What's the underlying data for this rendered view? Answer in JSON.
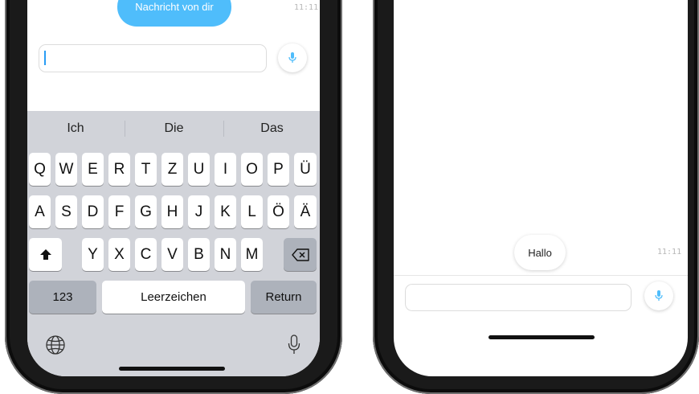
{
  "left_phone": {
    "message": {
      "text": "Nachricht von dir",
      "time": "11:11"
    },
    "input_value": "",
    "suggestions": [
      "Ich",
      "Die",
      "Das"
    ],
    "rows": [
      [
        "Q",
        "W",
        "E",
        "R",
        "T",
        "Z",
        "U",
        "I",
        "O",
        "P",
        "Ü"
      ],
      [
        "A",
        "S",
        "D",
        "F",
        "G",
        "H",
        "J",
        "K",
        "L",
        "Ö",
        "Ä"
      ],
      [
        "Y",
        "X",
        "C",
        "V",
        "B",
        "N",
        "M"
      ]
    ],
    "numbers_label": "123",
    "space_label": "Leerzeichen",
    "return_label": "Return",
    "icons": {
      "shift": "shift-icon",
      "delete": "backspace-icon",
      "globe": "globe-icon",
      "dictation": "microphone-icon",
      "mic_button": "microphone-icon"
    }
  },
  "right_phone": {
    "message": {
      "text": "Hallo",
      "time": "11:11"
    },
    "input_value": "",
    "icons": {
      "mic_button": "microphone-icon"
    }
  },
  "colors": {
    "accent": "#4fbdfb",
    "keyboard_bg": "#d1d3d9",
    "dark_key": "#adb2bb"
  }
}
